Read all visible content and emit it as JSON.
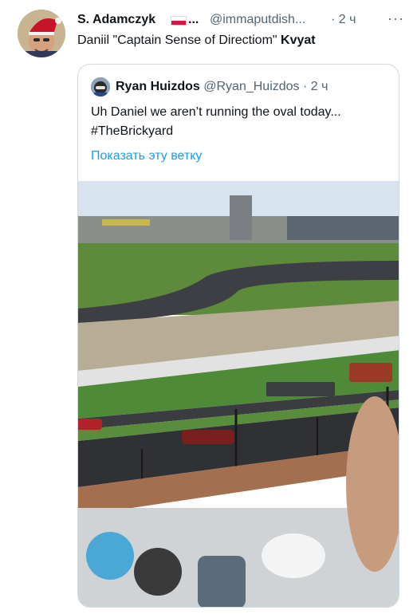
{
  "tweet": {
    "author_name": "S. Adamczyk",
    "name_ellipsis": "...",
    "handle": "@immaputdish...",
    "time": "· 2 ч",
    "more_label": "···",
    "text_prefix": "Daniil \"Captain Sense of Directiom\" ",
    "text_bold": "Kvyat"
  },
  "quote": {
    "author_name": "Ryan Huizdos",
    "handle": "@Ryan_Huizdos",
    "time": "· 2 ч",
    "text_line1": "Uh Daniel we aren’t running the oval today...",
    "text_line2": "#TheBrickyard",
    "show_thread": "Показать эту ветку"
  },
  "colors": {
    "accent_link": "#1d9bf0",
    "secondary_text": "#536471",
    "border": "#cfd9de"
  },
  "icons": [
    "avatar-santa-hat",
    "poland-flag-icon",
    "more-options-icon",
    "avatar-racing-helmet"
  ]
}
